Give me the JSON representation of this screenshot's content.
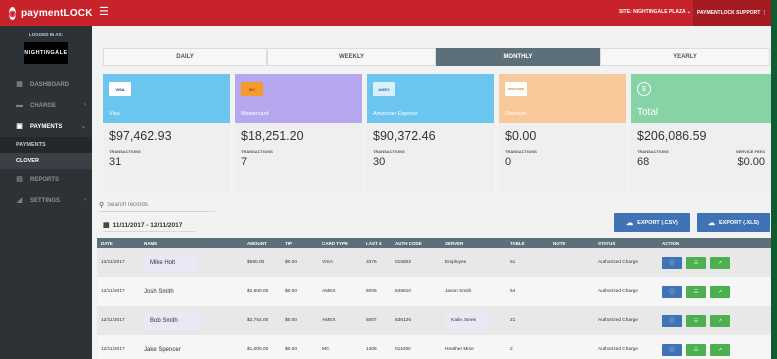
{
  "brand": {
    "name": "paymentLOCK"
  },
  "topbar": {
    "site": "SITE: NIGHTINGALE PLAZA ⌄",
    "support": "PAYMENTLOCK SUPPORT ⋮"
  },
  "sidebar": {
    "logged_in_label": "LOGGED IN AS:",
    "venue_logo": "NIGHTINGALE",
    "items": [
      {
        "label": "DASHBOARD",
        "icon": "dashboard-icon",
        "glyph": "▦"
      },
      {
        "label": "CHARGE",
        "icon": "charge-icon",
        "glyph": "▬",
        "chevron": "›"
      },
      {
        "label": "PAYMENTS",
        "icon": "payments-icon",
        "glyph": "▣",
        "chevron": "⌄"
      },
      {
        "label": "REPORTS",
        "icon": "reports-icon",
        "glyph": "▤"
      },
      {
        "label": "SETTINGS",
        "icon": "settings-icon",
        "glyph": "◢",
        "chevron": "›"
      }
    ],
    "subitems": [
      {
        "label": "PAYMENTS"
      },
      {
        "label": "CLOVER"
      }
    ]
  },
  "periods": [
    "DAILY",
    "WEEKLY",
    "MONTHLY",
    "YEARLY"
  ],
  "active_period": "MONTHLY",
  "cards": [
    {
      "label": "Visa",
      "logo": "VISA",
      "amount": "$97,462.93",
      "tlabel": "TRANSACTIONS",
      "count": "31",
      "color": "#6cc5ee"
    },
    {
      "label": "Mastercard",
      "logo": "MC",
      "amount": "$18,251.20",
      "tlabel": "TRANSACTIONS",
      "count": "7",
      "color": "#b7a7ee"
    },
    {
      "label": "American Express",
      "logo": "AMEX",
      "amount": "$90,372.46",
      "tlabel": "TRANSACTIONS",
      "count": "30",
      "color": "#6cc5ee"
    },
    {
      "label": "Discover",
      "logo": "DISCOVER",
      "amount": "$0.00",
      "tlabel": "TRANSACTIONS",
      "count": "0",
      "color": "#f7c89a"
    }
  ],
  "total": {
    "label": "Total",
    "amount": "$206,086.59",
    "tlabel": "TRANSACTIONS",
    "count": "68",
    "fee_label": "SERVICE FEES",
    "fee": "$0.00",
    "color": "#86d3a6"
  },
  "search": {
    "placeholder": "Search records"
  },
  "daterange": "11/11/2017 - 12/11/2017",
  "exports": {
    "csv": "EXPORT (.CSV)",
    "xls": "EXPORT (.XLS)"
  },
  "table": {
    "headers": [
      "DATE",
      "NAME",
      "AMOUNT",
      "TIP",
      "CARD TYPE",
      "LAST 4",
      "AUTH CODE",
      "SERVER",
      "TABLE",
      "NOTE",
      "STATUS",
      "ACTION"
    ],
    "rows": [
      {
        "date": "12/11/2017",
        "name": "Mike Holt",
        "amount": "$580.00",
        "tip": "$0.00",
        "card": "VISA",
        "last4": "3375",
        "auth": "015802",
        "server": "Employee",
        "table": "51",
        "note": "",
        "status": "Authorized Charge"
      },
      {
        "date": "12/11/2017",
        "name": "Josh Smith",
        "amount": "$2,600.00",
        "tip": "$0.00",
        "card": "AMEX",
        "last4": "6005",
        "auth": "846810",
        "server": "Jason Smith",
        "table": "54",
        "note": "",
        "status": "Authorized Charge"
      },
      {
        "date": "12/11/2017",
        "name": "Bob Smith",
        "amount": "$2,754.00",
        "tip": "$0.00",
        "card": "AMEX",
        "last4": "6007",
        "auth": "836126",
        "server": "Katie Jones",
        "table": "21",
        "note": "",
        "status": "Authorized Charge"
      },
      {
        "date": "12/11/2017",
        "name": "Jake Spencer",
        "amount": "$1,000.00",
        "tip": "$0.00",
        "card": "MC",
        "last4": "1308",
        "auth": "011090",
        "server": "Heather Mine",
        "table": "2",
        "note": "",
        "status": "Authorized Charge"
      }
    ]
  },
  "colors": {
    "red": "#c8232b",
    "sidebar": "#2d3236",
    "slate": "#5d7079",
    "blue": "#3f73b5",
    "green": "#4caf50"
  }
}
